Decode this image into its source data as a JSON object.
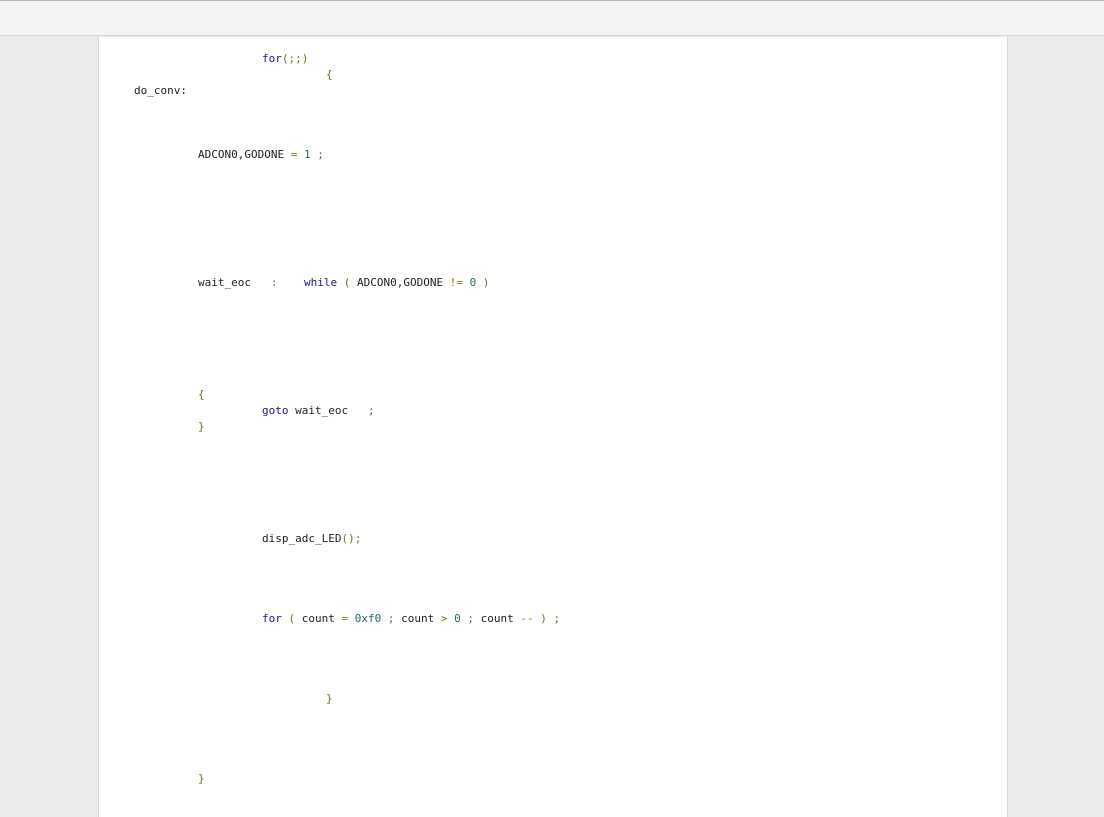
{
  "code_lines": [
    {
      "tokens": [
        {
          "t": "for",
          "c": "kw"
        },
        {
          "t": "(;;)",
          "c": "pun"
        }
      ]
    },
    {
      "tokens": [
        {
          "t": "{",
          "c": "pun"
        }
      ]
    },
    {
      "tokens": [
        {
          "t": "do_conv:",
          "c": "id"
        }
      ]
    },
    {
      "tokens": [
        {
          "t": "ADCON0,GODONE",
          "c": "id"
        },
        {
          "t": " = ",
          "c": "op"
        },
        {
          "t": "1",
          "c": "num"
        },
        {
          "t": " ;",
          "c": "pun"
        }
      ]
    },
    {
      "tokens": [
        {
          "t": "wait_eoc",
          "c": "id"
        },
        {
          "t": "   :    ",
          "c": "pun"
        },
        {
          "t": "while",
          "c": "kw"
        },
        {
          "t": " ( ",
          "c": "pun"
        },
        {
          "t": "ADCON0,GODONE",
          "c": "id"
        },
        {
          "t": " != ",
          "c": "op"
        },
        {
          "t": "0",
          "c": "num"
        },
        {
          "t": " )",
          "c": "pun"
        }
      ]
    },
    {
      "tokens": [
        {
          "t": "{",
          "c": "pun"
        }
      ]
    },
    {
      "tokens": [
        {
          "t": "goto",
          "c": "kw"
        },
        {
          "t": " wait_eoc",
          "c": "id"
        },
        {
          "t": "   ;",
          "c": "pun"
        }
      ]
    },
    {
      "tokens": [
        {
          "t": "}",
          "c": "pun"
        }
      ]
    },
    {
      "tokens": [
        {
          "t": "disp_adc_LED",
          "c": "id"
        },
        {
          "t": "();",
          "c": "pun"
        }
      ]
    },
    {
      "tokens": [
        {
          "t": "for",
          "c": "kw"
        },
        {
          "t": " ( ",
          "c": "pun"
        },
        {
          "t": "count",
          "c": "id"
        },
        {
          "t": " = ",
          "c": "op"
        },
        {
          "t": "0xf0",
          "c": "num"
        },
        {
          "t": " ; ",
          "c": "pun"
        },
        {
          "t": "count",
          "c": "id"
        },
        {
          "t": " > ",
          "c": "op"
        },
        {
          "t": "0",
          "c": "num"
        },
        {
          "t": " ; ",
          "c": "pun"
        },
        {
          "t": "count",
          "c": "id"
        },
        {
          "t": " -- ",
          "c": "op"
        },
        {
          "t": ") ;",
          "c": "pun"
        }
      ]
    },
    {
      "tokens": [
        {
          "t": "}",
          "c": "pun"
        }
      ]
    },
    {
      "tokens": [
        {
          "t": "}",
          "c": "pun"
        }
      ]
    }
  ]
}
